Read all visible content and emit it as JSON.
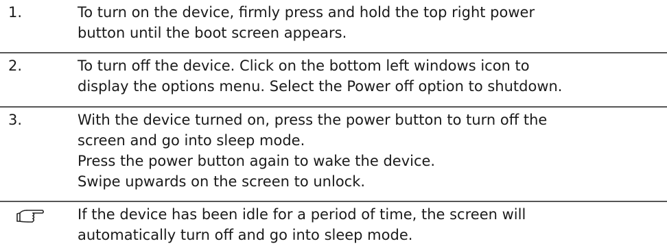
{
  "steps": [
    {
      "number": "1.",
      "lines": [
        "To turn on the device, firmly press and hold the top right power",
        "button until the boot screen appears."
      ]
    },
    {
      "number": "2.",
      "lines": [
        "To turn off the device. Click on the bottom left windows icon to",
        "display the options menu. Select the Power off option to shutdown."
      ]
    },
    {
      "number": "3.",
      "lines": [
        "With the device turned on, press the power button to turn off the",
        "screen and go into sleep mode.",
        "Press the power button again to wake the device.",
        "Swipe upwards on the screen to unlock."
      ]
    }
  ],
  "note": {
    "icon": "pointing-hand-icon",
    "lines": [
      "If the device has been idle for a period of time, the screen will",
      "automatically turn off and go into sleep mode."
    ]
  }
}
